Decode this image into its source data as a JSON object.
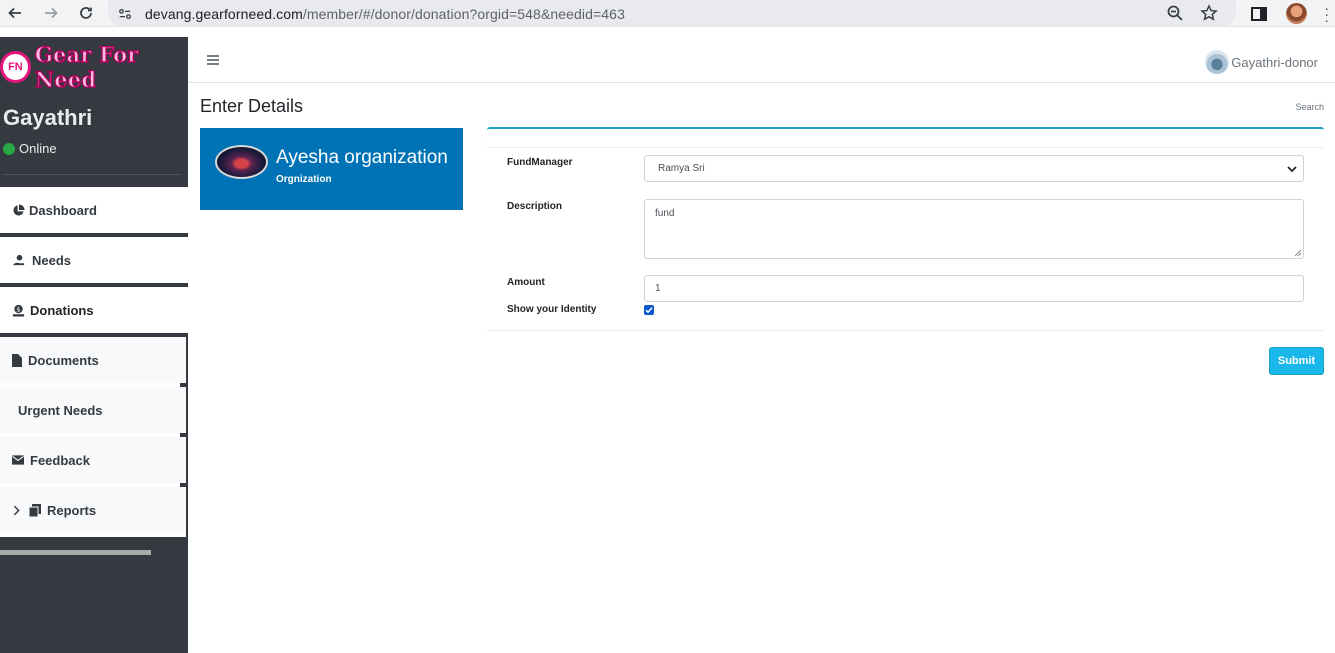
{
  "browser": {
    "url_host": "devang.gearforneed.com",
    "url_path": "/member/#/donor/donation?orgid=548&needid=463"
  },
  "sidebar": {
    "brand": "Gear For Need",
    "brand_logo_text": "FN",
    "user_name": "Gayathri",
    "status": "Online",
    "items": [
      {
        "label": "Dashboard",
        "icon": "pie-chart-icon"
      },
      {
        "label": "Needs",
        "icon": "hand-holding-icon"
      },
      {
        "label": "Donations",
        "icon": "donate-icon"
      },
      {
        "label": "Documents",
        "icon": "file-icon"
      },
      {
        "label": "Urgent Needs",
        "icon": ""
      },
      {
        "label": "Feedback",
        "icon": "envelope-icon"
      },
      {
        "label": "Reports",
        "icon": "copy-icon"
      }
    ]
  },
  "topbar": {
    "user_label": "Gayathri-donor"
  },
  "main": {
    "title": "Enter Details",
    "search_label": "Search",
    "org": {
      "name": "Ayesha organization",
      "type": "Orgnization"
    },
    "form": {
      "fund_manager_label": "FundManager",
      "fund_manager_value": "Ramya Sri",
      "description_label": "Description",
      "description_value": "fund",
      "amount_label": "Amount",
      "amount_value": "1",
      "identity_label": "Show your Identity",
      "identity_checked": true,
      "submit_label": "Submit"
    }
  },
  "colors": {
    "sidebar_bg": "#343a40",
    "org_card_bg": "#0073b7",
    "accent": "#17a2b8",
    "submit_bg": "#1ab7ea",
    "online": "#28a745"
  }
}
